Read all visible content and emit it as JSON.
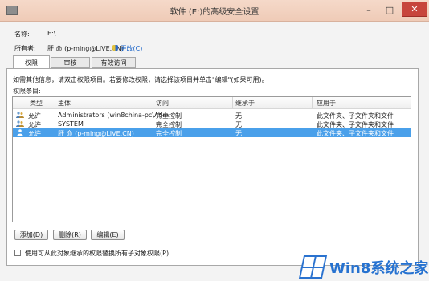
{
  "window": {
    "title": "软件 (E:)的高级安全设置",
    "controls": {
      "minimize": "–",
      "maximize": "□",
      "close": "✕"
    }
  },
  "info": {
    "name_label": "名称:",
    "name_value": "E:\\",
    "owner_label": "所有者:",
    "owner_value": "肝 命 (p-ming@LIVE.CN)",
    "change_link": "更改(C)"
  },
  "tabs": [
    "权限",
    "审核",
    "有效访问"
  ],
  "instructions": "如需其他信息，请双击权限项目。若要修改权限，请选择该项目并单击\"编辑\"(如果可用)。",
  "entries_label": "权限条目:",
  "table": {
    "headers": [
      "类型",
      "主体",
      "访问",
      "继承于",
      "应用于"
    ],
    "rows": [
      {
        "type": "允许",
        "principal": "Administrators (win8china-pc\\Adm...",
        "access": "完全控制",
        "inherited": "无",
        "applies": "此文件夹、子文件夹和文件",
        "icon": "group-icon"
      },
      {
        "type": "允许",
        "principal": "SYSTEM",
        "access": "完全控制",
        "inherited": "无",
        "applies": "此文件夹、子文件夹和文件",
        "icon": "group-icon"
      },
      {
        "type": "允许",
        "principal": "肝 命 (p-ming@LIVE.CN)",
        "access": "完全控制",
        "inherited": "无",
        "applies": "此文件夹、子文件夹和文件",
        "icon": "user-icon",
        "selected": true
      }
    ]
  },
  "buttons": {
    "add": "添加(D)",
    "remove": "删除(R)",
    "edit": "编辑(E)"
  },
  "replace_checkbox": "使用可从此对象继承的权限替换所有子对象权限(P)",
  "watermark": "Win8系统之家",
  "colors": {
    "accent": "#4aa0ea",
    "titlebar": "#efcbb7",
    "close": "#c7453c",
    "watermark": "#2672d0"
  }
}
